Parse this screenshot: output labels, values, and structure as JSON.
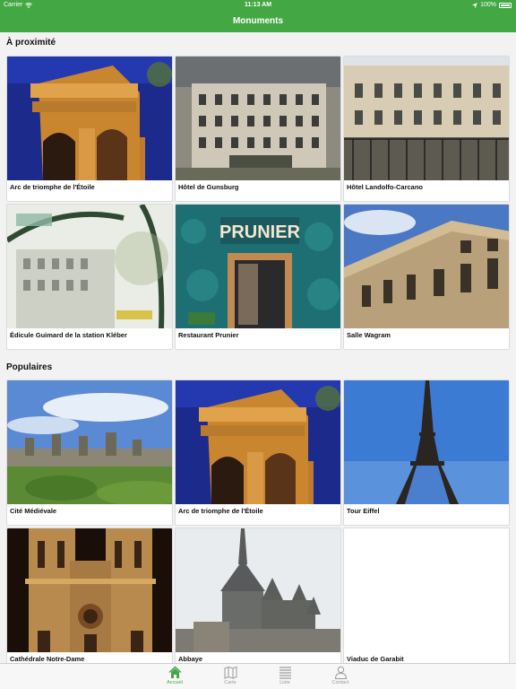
{
  "status_bar": {
    "carrier": "Carrier",
    "time": "11:13 AM",
    "battery": "100%"
  },
  "nav": {
    "title": "Monuments"
  },
  "sections": {
    "nearby": {
      "title": "À proximité",
      "items": [
        {
          "label": "Arc de triomphe de l'Étoile"
        },
        {
          "label": "Hôtel de Gunsburg"
        },
        {
          "label": "Hôtel Landolfo-Carcano"
        },
        {
          "label": "Édicule Guimard de la station Kléber"
        },
        {
          "label": "Restaurant Prunier",
          "sign": "PRUNIER"
        },
        {
          "label": "Salle Wagram"
        }
      ]
    },
    "popular": {
      "title": "Populaires",
      "items": [
        {
          "label": "Cité Médiévale"
        },
        {
          "label": "Arc de triomphe de l'Étoile"
        },
        {
          "label": "Tour Eiffel"
        },
        {
          "label": "Cathédrale Notre-Dame"
        },
        {
          "label": "Abbaye"
        },
        {
          "label": "Viaduc de Garabit"
        }
      ]
    }
  },
  "tabs": [
    {
      "label": "Accueil",
      "icon": "home-icon",
      "active": true
    },
    {
      "label": "Carte",
      "icon": "map-icon",
      "active": false
    },
    {
      "label": "Liste",
      "icon": "list-icon",
      "active": false
    },
    {
      "label": "Contact",
      "icon": "person-icon",
      "active": false
    }
  ],
  "colors": {
    "accent": "#43a843",
    "tab_inactive": "#9a9a9a",
    "background": "#f2f2f2"
  }
}
